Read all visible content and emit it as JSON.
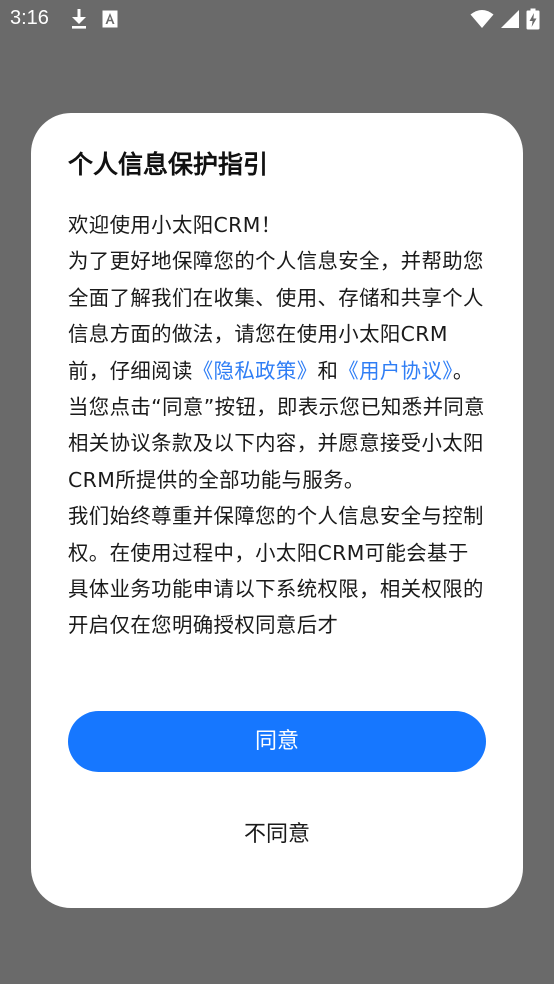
{
  "status_bar": {
    "time": "3:16",
    "icons": [
      "download-icon",
      "a-notification-icon",
      "wifi-icon",
      "signal-icon",
      "battery-icon"
    ]
  },
  "dialog": {
    "title": "个人信息保护指引",
    "paragraphs": {
      "p1": "欢迎使用小太阳CRM！",
      "p2_a": "为了更好地保障您的个人信息安全，并帮助您全面了解我们在收集、使用、存储和共享个人信息方面的做法，请您在使用小太阳CRM前，仔细阅读",
      "privacy_link": "《隐私政策》",
      "p2_and": "和",
      "user_agreement_link": "《用户协议》",
      "p2_b": "。当您点击“同意”按钮，即表示您已知悉并同意相关协议条款及以下内容，并愿意接受小太阳CRM所提供的全部功能与服务。",
      "p3": "我们始终尊重并保障您的个人信息安全与控制权。在使用过程中，小太阳CRM可能会基于具体业务功能申请以下系统权限，相关权限的开启仅在您明确授权同意后才"
    },
    "agree_label": "同意",
    "disagree_label": "不同意"
  },
  "colors": {
    "backdrop": "#6a6a6a",
    "primary": "#1677ff",
    "link": "#2f7ef5"
  }
}
